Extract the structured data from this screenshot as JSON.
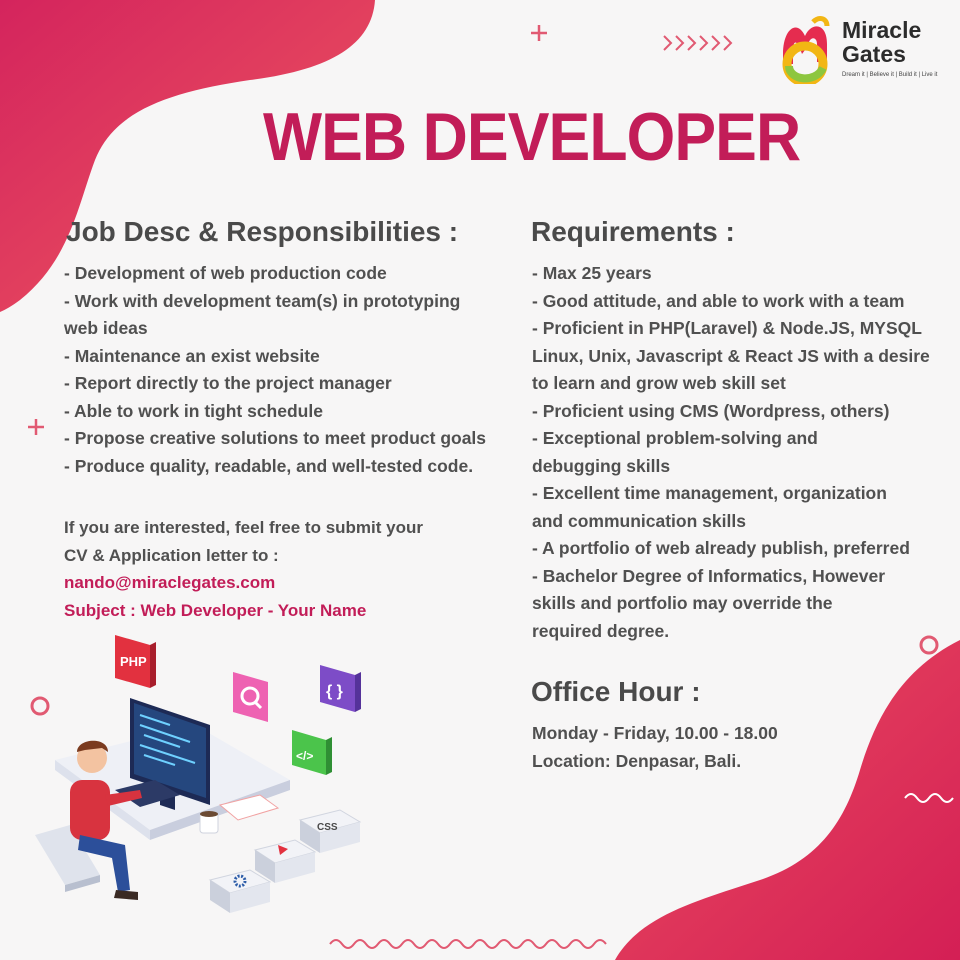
{
  "brand": {
    "name_line1": "Miracle",
    "name_line2": "Gates",
    "tagline": "Dream it | Believe it | Build it | Live it"
  },
  "title": "WEB DEVELOPER",
  "job_desc": {
    "heading": "Job Desc & Responsibilities :",
    "lines": [
      "- Development of web production code",
      "- Work with development team(s) in prototyping",
      "web ideas",
      "- Maintenance an exist website",
      "- Report directly to the project manager",
      "- Able to work in tight schedule",
      "- Propose creative solutions to meet product goals",
      "- Produce quality, readable, and well-tested code."
    ]
  },
  "apply": {
    "line1": "If you are interested, feel free to submit your",
    "line2": "CV & Application letter to :",
    "email": "nando@miraclegates.com",
    "subject": "Subject : Web Developer - Your Name"
  },
  "requirements": {
    "heading": "Requirements :",
    "lines": [
      "- Max 25 years",
      "- Good attitude, and able to work with a team",
      "- Proficient in PHP(Laravel) & Node.JS, MYSQL",
      "Linux, Unix, Javascript & React JS with a desire",
      "to learn and grow web skill set",
      "- Proficient using CMS (Wordpress, others)",
      "- Exceptional problem-solving and",
      "debugging skills",
      "- Excellent time management, organization",
      "and communication skills",
      "- A portfolio of web already publish, preferred",
      "- Bachelor Degree of Informatics, However",
      "skills and portfolio may override the",
      "required degree."
    ]
  },
  "office": {
    "heading": "Office Hour :",
    "hours": "Monday - Friday, 10.00 - 18.00",
    "location": "Location: Denpasar, Bali."
  },
  "illustration": {
    "php_label": "PHP",
    "code_label": "</>",
    "braces_label": "{ }",
    "css_label": "CSS"
  },
  "colors": {
    "accent": "#c21d58",
    "blob": "#e94f62",
    "text": "#4a4a4a"
  }
}
